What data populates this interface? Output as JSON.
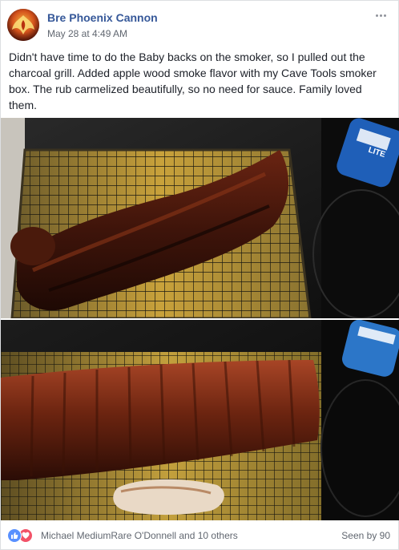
{
  "post": {
    "author": "Bre Phoenix Cannon",
    "timestamp": "May 28 at 4:49 AM",
    "text": "Didn't have time to do the Baby backs on the smoker, so I pulled out the charcoal grill. Added apple wood smoke flavor with my Cave Tools smoker box. The rub carmelized beautifully, so no need for sauce. Family loved them.",
    "images": [
      {
        "subject": "rack of ribs on cooling rack",
        "can_text": "LITE"
      },
      {
        "subject": "rack of ribs on cooling rack, meat side up",
        "can_text": ""
      }
    ]
  },
  "footer": {
    "reactions": [
      "like-icon",
      "love-icon"
    ],
    "reactors": "Michael MediumRare O'Donnell and 10 others",
    "seen_by": "Seen by 90"
  },
  "colors": {
    "author": "#365899",
    "meta": "#616770",
    "like": "#5890ff",
    "love": "#f25268"
  }
}
